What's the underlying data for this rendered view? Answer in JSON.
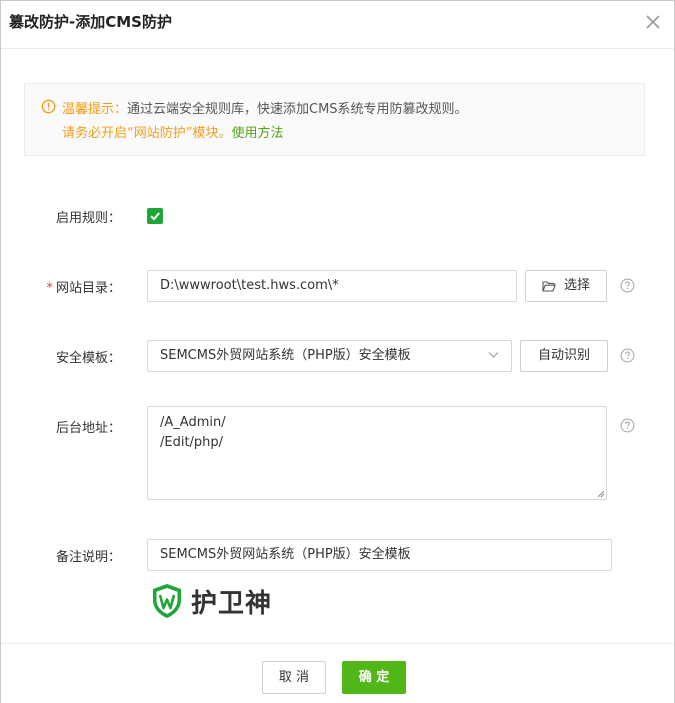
{
  "dialog": {
    "title": "篡改防护-添加CMS防护",
    "close_icon": "close-icon"
  },
  "tip": {
    "icon": "info-circle-icon",
    "lead": "温馨提示：",
    "line1_rest": "通过云端安全规则库，快速添加CMS系统专用防篡改规则。",
    "line2_warn": "请务必开启“网站防护”模块。",
    "line2_link": "使用方法"
  },
  "form": {
    "enable": {
      "label": "启用规则：",
      "checked": true
    },
    "site_dir": {
      "required_mark": "*",
      "label": "网站目录：",
      "value": "D:\\wwwroot\\test.hws.com\\*",
      "choose_label": "选择"
    },
    "template": {
      "label": "安全模板：",
      "value": "SEMCMS外贸网站系统（PHP版）安全模板",
      "auto_label": "自动识别"
    },
    "admin_path": {
      "label": "后台地址：",
      "lines": [
        "/A_Admin/",
        "/Edit/php/"
      ]
    },
    "note": {
      "label": "备注说明：",
      "value": "SEMCMS外贸网站系统（PHP版）安全模板"
    }
  },
  "brand": {
    "name": "护卫神",
    "accent": "#20a53a"
  },
  "footer": {
    "cancel_label": "取 消",
    "ok_label": "确 定"
  },
  "colors": {
    "primary": "#51b618",
    "warning": "#f39c12",
    "link": "#52a41b",
    "required": "#e0403a"
  }
}
